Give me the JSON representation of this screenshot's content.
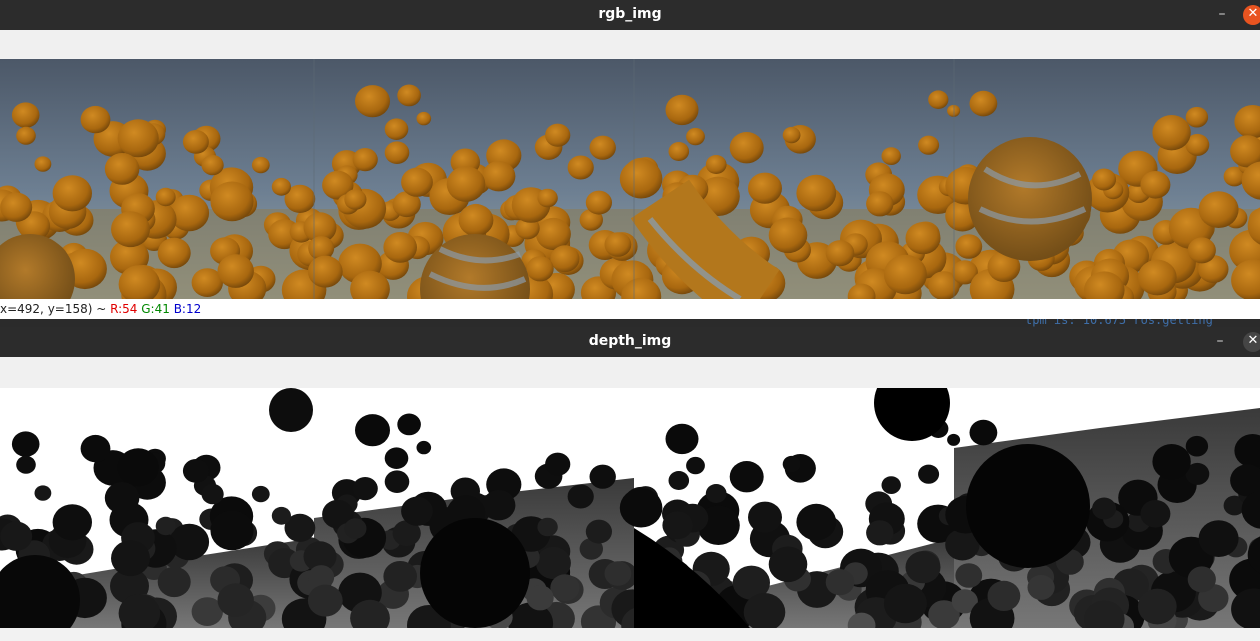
{
  "rgb_window": {
    "title": "rgb_img",
    "minimize_glyph": "–",
    "close_glyph": "✕",
    "status": {
      "coords": "x=492, y=158) ~ ",
      "r": "R:54",
      "g": "G:41",
      "b": "B:12"
    }
  },
  "depth_window": {
    "title": "depth_img",
    "minimize_glyph": "–",
    "close_glyph": "✕"
  },
  "background_terminal": {
    "text": "tpm is: 10.675 ros.getting"
  },
  "colors": {
    "titlebar": "#2c2c2c",
    "close_active": "#e95420",
    "status_r": "#e00000",
    "status_g": "#008800",
    "status_b": "#0000cc",
    "sphere": "#b8761a"
  }
}
